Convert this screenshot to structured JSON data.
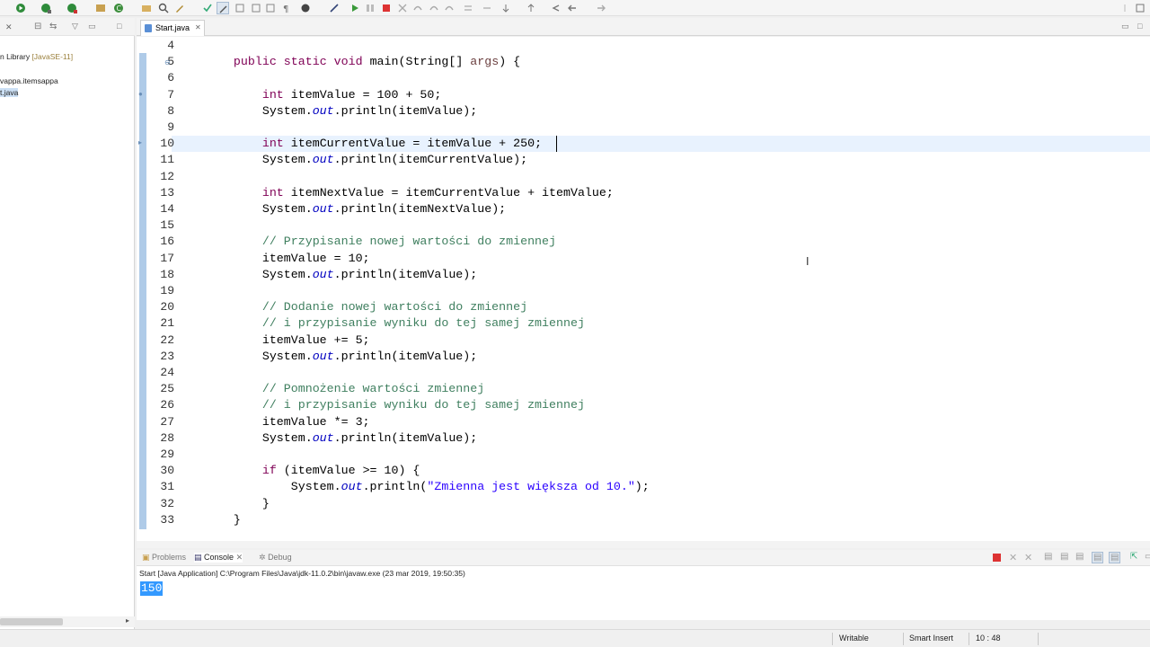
{
  "editor": {
    "tab_label": "Start.java",
    "lines": [
      {
        "n": "4",
        "html": ""
      },
      {
        "n": "5",
        "html": "    <span class=\"kw\">public</span> <span class=\"kw\">static</span> <span class=\"kw\">void</span> main(String[] <span class=\"pm\">args</span>) {"
      },
      {
        "n": "6",
        "html": ""
      },
      {
        "n": "7",
        "html": "        <span class=\"kw\">int</span> itemValue = 100 + 50;"
      },
      {
        "n": "8",
        "html": "        System.<span class=\"it\">out</span>.println(itemValue);"
      },
      {
        "n": "9",
        "html": ""
      },
      {
        "n": "10",
        "html": "        <span class=\"kw\">int</span> itemCurrentValue = itemValue + 250;"
      },
      {
        "n": "11",
        "html": "        System.<span class=\"it\">out</span>.println(itemCurrentValue);"
      },
      {
        "n": "12",
        "html": ""
      },
      {
        "n": "13",
        "html": "        <span class=\"kw\">int</span> itemNextValue = itemCurrentValue + itemValue;"
      },
      {
        "n": "14",
        "html": "        System.<span class=\"it\">out</span>.println(itemNextValue);"
      },
      {
        "n": "15",
        "html": ""
      },
      {
        "n": "16",
        "html": "        <span class=\"cm\">// Przypisanie nowej wartości do zmiennej</span>"
      },
      {
        "n": "17",
        "html": "        itemValue = 10;"
      },
      {
        "n": "18",
        "html": "        System.<span class=\"it\">out</span>.println(itemValue);"
      },
      {
        "n": "19",
        "html": ""
      },
      {
        "n": "20",
        "html": "        <span class=\"cm\">// Dodanie nowej wartości do zmiennej</span>"
      },
      {
        "n": "21",
        "html": "        <span class=\"cm\">// i przypisanie wyniku do tej samej zmiennej</span>"
      },
      {
        "n": "22",
        "html": "        itemValue += 5;"
      },
      {
        "n": "23",
        "html": "        System.<span class=\"it\">out</span>.println(itemValue);"
      },
      {
        "n": "24",
        "html": ""
      },
      {
        "n": "25",
        "html": "        <span class=\"cm\">// Pomnożenie wartości zmiennej</span>"
      },
      {
        "n": "26",
        "html": "        <span class=\"cm\">// i przypisanie wyniku do tej samej zmiennej</span>"
      },
      {
        "n": "27",
        "html": "        itemValue *= 3;"
      },
      {
        "n": "28",
        "html": "        System.<span class=\"it\">out</span>.println(itemValue);"
      },
      {
        "n": "29",
        "html": ""
      },
      {
        "n": "30",
        "html": "        <span class=\"kw\">if</span> (itemValue >= 10) {"
      },
      {
        "n": "31",
        "html": "            System.<span class=\"it\">out</span>.println(<span class=\"st\">\"Zmienna jest większa od 10.\"</span>);"
      },
      {
        "n": "32",
        "html": "        }"
      },
      {
        "n": "33",
        "html": "    }"
      }
    ]
  },
  "explorer": {
    "items": [
      {
        "text": "n Library ",
        "extra": "[JavaSE-11]"
      },
      {
        "text": "vappa.itemsappa",
        "extra": ""
      },
      {
        "text": "t.java",
        "extra": ""
      }
    ]
  },
  "console": {
    "tabs": [
      "Problems",
      "Console",
      "Debug"
    ],
    "info": "Start [Java Application] C:\\Program Files\\Java\\jdk-11.0.2\\bin\\javaw.exe (23 mar 2019, 19:50:35)",
    "output": "150"
  },
  "status": {
    "writable": "Writable",
    "insert_mode": "Smart Insert",
    "position": "10 : 48"
  },
  "colors": {
    "keyword": "#7f0055",
    "comment": "#3f7f5f",
    "string": "#2a00ff",
    "static_field": "#0000c0",
    "current_line": "#e8f2fe",
    "selection": "#3399ff"
  }
}
